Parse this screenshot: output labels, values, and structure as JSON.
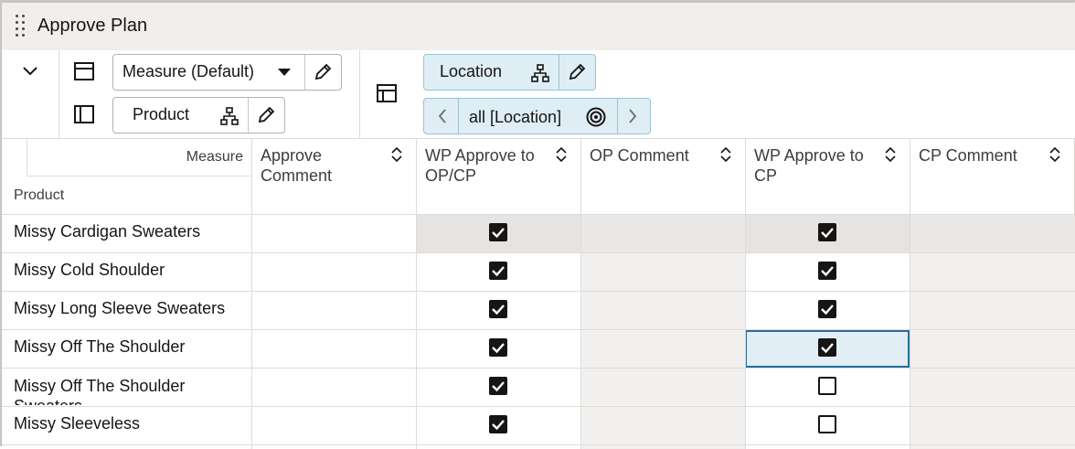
{
  "window": {
    "title": "Approve Plan"
  },
  "toolbar": {
    "measure_label": "Measure (Default)",
    "product_label": "Product",
    "location_label": "Location",
    "location_filter_label": "all [Location]"
  },
  "grid": {
    "corner": {
      "measure_label": "Measure",
      "product_label": "Product"
    },
    "columns": [
      {
        "label": "Approve Comment"
      },
      {
        "label": "WP Approve to OP/CP"
      },
      {
        "label": "OP Comment"
      },
      {
        "label": "WP Approve to CP"
      },
      {
        "label": "CP Comment"
      }
    ],
    "rows": [
      {
        "product": "Missy Cardigan Sweaters",
        "wp_approve_op_cp": true,
        "wp_approve_cp": true
      },
      {
        "product": "Missy Cold Shoulder",
        "wp_approve_op_cp": true,
        "wp_approve_cp": true
      },
      {
        "product": "Missy Long Sleeve Sweaters",
        "wp_approve_op_cp": true,
        "wp_approve_cp": true
      },
      {
        "product": "Missy Off The Shoulder",
        "wp_approve_op_cp": true,
        "wp_approve_cp": true
      },
      {
        "product": "Missy Off The Shoulder Sweaters",
        "wp_approve_op_cp": true,
        "wp_approve_cp": false
      },
      {
        "product": "Missy Sleeveless",
        "wp_approve_op_cp": true,
        "wp_approve_cp": false
      }
    ]
  },
  "colors": {
    "selected_cell": "#e1eef5",
    "selected_border": "#2b6d8f",
    "readonly_cell": "#f1f0ef",
    "current_row_cell": "#e5e4e2",
    "pill_bg": "#dfeef5"
  }
}
